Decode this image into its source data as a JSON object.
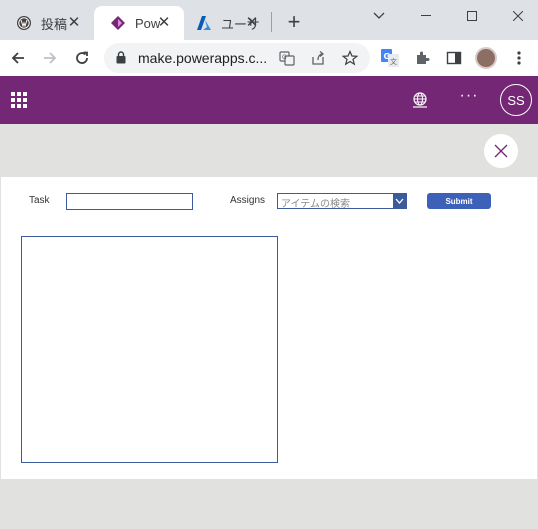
{
  "browser": {
    "tabs": [
      {
        "title": "投稿",
        "icon": "wordpress-icon",
        "active": false
      },
      {
        "title": "Pow",
        "icon": "powerapps-icon",
        "active": true
      },
      {
        "title": "ユーサ",
        "icon": "azure-icon",
        "active": false
      }
    ],
    "url": "make.powerapps.c..."
  },
  "app_header": {
    "more_label": "···",
    "user_initials": "SS",
    "brand_color": "#742774"
  },
  "form": {
    "task_label": "Task",
    "task_value": "",
    "assigns_label": "Assigns",
    "assigns_placeholder": "アイテムの検索",
    "submit_label": "Submit"
  }
}
